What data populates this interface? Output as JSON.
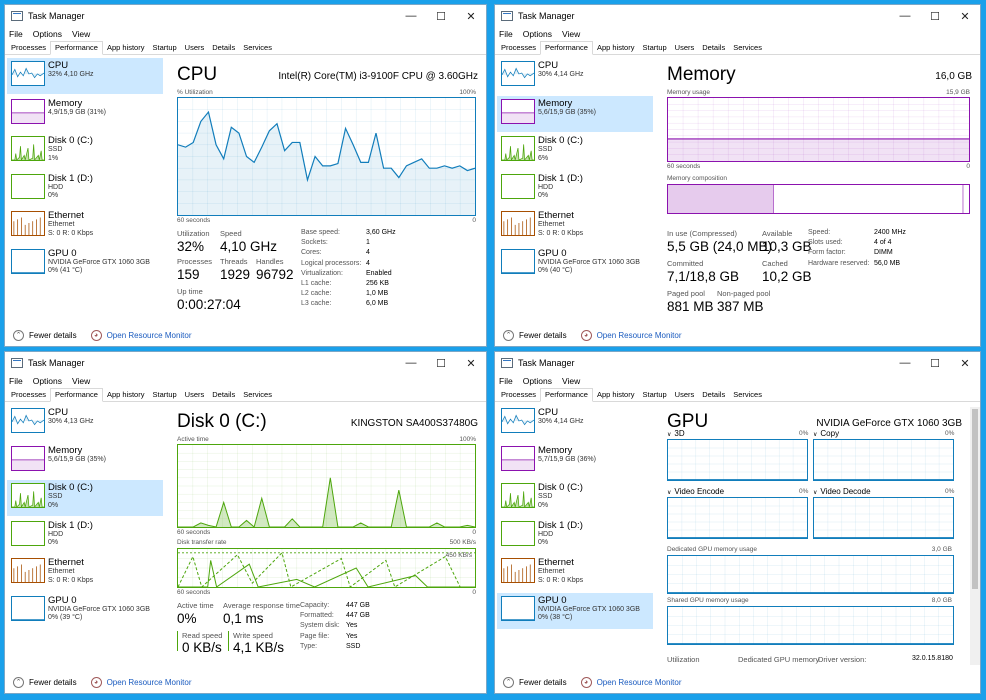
{
  "common": {
    "window_title": "Task Manager",
    "menu": [
      "File",
      "Options",
      "View"
    ],
    "tabs": [
      "Processes",
      "Performance",
      "App history",
      "Startup",
      "Users",
      "Details",
      "Services"
    ],
    "fewer_details": "Fewer details",
    "open_resource_monitor": "Open Resource Monitor",
    "colors": {
      "cpu": "#117dbb",
      "memory": "#8b12ae",
      "disk": "#4da60c",
      "ethernet": "#a74f01",
      "gpu": "#117dbb"
    }
  },
  "windows": [
    {
      "id": "cpu",
      "sidebar": [
        {
          "name": "CPU",
          "sub1": "32% 4,10 GHz",
          "sub2": "",
          "sub3": ""
        },
        {
          "name": "Memory",
          "sub1": "4,9/15,9 GB (31%)",
          "sub2": "",
          "sub3": ""
        },
        {
          "name": "Disk 0 (C:)",
          "sub1": "SSD",
          "sub2": "1%",
          "sub3": ""
        },
        {
          "name": "Disk 1 (D:)",
          "sub1": "HDD",
          "sub2": "0%",
          "sub3": ""
        },
        {
          "name": "Ethernet",
          "sub1": "Ethernet",
          "sub2": "S: 0 R: 0 Kbps",
          "sub3": ""
        },
        {
          "name": "GPU 0",
          "sub1": "NVIDIA GeForce GTX 1060 3GB",
          "sub2": "0% (41 °C)",
          "sub3": ""
        }
      ],
      "title": "CPU",
      "device": "Intel(R) Core(TM) i3-9100F CPU @ 3.60GHz",
      "graph_label_left": "% Utilization",
      "graph_label_right": "100%",
      "graph_bottom_left": "60 seconds",
      "graph_bottom_right": "0",
      "utilization_series": [
        60,
        58,
        62,
        80,
        88,
        60,
        48,
        75,
        70,
        50,
        45,
        58,
        72,
        78,
        55,
        62,
        62,
        30,
        50,
        42,
        42,
        44,
        74,
        60,
        45,
        45,
        70,
        40,
        40,
        32,
        42,
        45,
        48,
        40,
        40,
        42,
        40,
        42,
        38,
        40
      ],
      "stats": {
        "utilization_label": "Utilization",
        "utilization": "32%",
        "speed_label": "Speed",
        "speed": "4,10 GHz",
        "processes_label": "Processes",
        "processes": "159",
        "threads_label": "Threads",
        "threads": "1929",
        "handles_label": "Handles",
        "handles": "96792",
        "uptime_label": "Up time",
        "uptime": "0:00:27:04"
      },
      "specs": [
        {
          "k": "Base speed:",
          "v": "3,60 GHz"
        },
        {
          "k": "Sockets:",
          "v": "1"
        },
        {
          "k": "Cores:",
          "v": "4"
        },
        {
          "k": "Logical processors:",
          "v": "4"
        },
        {
          "k": "Virtualization:",
          "v": "Enabled"
        },
        {
          "k": "L1 cache:",
          "v": "256 KB"
        },
        {
          "k": "L2 cache:",
          "v": "1,0 MB"
        },
        {
          "k": "L3 cache:",
          "v": "6,0 MB"
        }
      ]
    },
    {
      "id": "memory",
      "sidebar": [
        {
          "name": "CPU",
          "sub1": "30% 4,14 GHz",
          "sub2": "",
          "sub3": ""
        },
        {
          "name": "Memory",
          "sub1": "5,6/15,9 GB (35%)",
          "sub2": "",
          "sub3": ""
        },
        {
          "name": "Disk 0 (C:)",
          "sub1": "SSD",
          "sub2": "6%",
          "sub3": ""
        },
        {
          "name": "Disk 1 (D:)",
          "sub1": "HDD",
          "sub2": "0%",
          "sub3": ""
        },
        {
          "name": "Ethernet",
          "sub1": "Ethernet",
          "sub2": "S: 0 R: 0 Kbps",
          "sub3": ""
        },
        {
          "name": "GPU 0",
          "sub1": "NVIDIA GeForce GTX 1060 3GB",
          "sub2": "0% (40 °C)",
          "sub3": ""
        }
      ],
      "title": "Memory",
      "device": "16,0 GB",
      "usage_label": "Memory usage",
      "usage_max": "15,9 GB",
      "usage_bottom_left": "60 seconds",
      "usage_bottom_right": "0",
      "usage_fraction": 0.35,
      "composition_label": "Memory composition",
      "stats": {
        "inuse_label": "In use (Compressed)",
        "inuse": "5,5 GB (24,0 MB)",
        "available_label": "Available",
        "available": "10,3 GB",
        "committed_label": "Committed",
        "committed": "7,1/18,8 GB",
        "cached_label": "Cached",
        "cached": "10,2 GB",
        "paged_label": "Paged pool",
        "paged": "881 MB",
        "nonpaged_label": "Non-paged pool",
        "nonpaged": "387 MB"
      },
      "specs": [
        {
          "k": "Speed:",
          "v": "2400 MHz"
        },
        {
          "k": "Slots used:",
          "v": "4 of 4"
        },
        {
          "k": "Form factor:",
          "v": "DIMM"
        },
        {
          "k": "Hardware reserved:",
          "v": "56,0 MB"
        }
      ]
    },
    {
      "id": "disk",
      "sidebar": [
        {
          "name": "CPU",
          "sub1": "30% 4,13 GHz",
          "sub2": "",
          "sub3": ""
        },
        {
          "name": "Memory",
          "sub1": "5,6/15,9 GB (35%)",
          "sub2": "",
          "sub3": ""
        },
        {
          "name": "Disk 0 (C:)",
          "sub1": "SSD",
          "sub2": "0%",
          "sub3": ""
        },
        {
          "name": "Disk 1 (D:)",
          "sub1": "HDD",
          "sub2": "0%",
          "sub3": ""
        },
        {
          "name": "Ethernet",
          "sub1": "Ethernet",
          "sub2": "S: 0 R: 0 Kbps",
          "sub3": ""
        },
        {
          "name": "GPU 0",
          "sub1": "NVIDIA GeForce GTX 1060 3GB",
          "sub2": "0% (39 °C)",
          "sub3": ""
        }
      ],
      "title": "Disk 0 (C:)",
      "device": "KINGSTON SA400S37480G",
      "active_label": "Active time",
      "active_max": "100%",
      "active_bottom_left": "60 seconds",
      "active_bottom_right": "0",
      "transfer_label": "Disk transfer rate",
      "transfer_max": "500 KB/s",
      "transfer_line_label": "450 KB/s",
      "transfer_bottom_left": "60 seconds",
      "transfer_bottom_right": "0",
      "active_series": [
        0,
        0,
        0,
        5,
        2,
        0,
        30,
        0,
        0,
        8,
        0,
        35,
        0,
        0,
        0,
        10,
        0,
        0,
        0,
        0,
        60,
        0,
        0,
        0,
        5,
        0,
        0,
        0,
        0,
        45,
        0,
        0,
        0,
        0,
        5,
        0,
        0,
        0,
        2,
        0
      ],
      "stats": {
        "active_label": "Active time",
        "active": "0%",
        "response_label": "Average response time",
        "response": "0,1 ms",
        "read_label": "Read speed",
        "read": "0 KB/s",
        "write_label": "Write speed",
        "write": "4,1 KB/s"
      },
      "specs": [
        {
          "k": "Capacity:",
          "v": "447 GB"
        },
        {
          "k": "Formatted:",
          "v": "447 GB"
        },
        {
          "k": "System disk:",
          "v": "Yes"
        },
        {
          "k": "Page file:",
          "v": "Yes"
        },
        {
          "k": "Type:",
          "v": "SSD"
        }
      ]
    },
    {
      "id": "gpu",
      "sidebar": [
        {
          "name": "CPU",
          "sub1": "30% 4,14 GHz",
          "sub2": "",
          "sub3": ""
        },
        {
          "name": "Memory",
          "sub1": "5,7/15,9 GB (36%)",
          "sub2": "",
          "sub3": ""
        },
        {
          "name": "Disk 0 (C:)",
          "sub1": "SSD",
          "sub2": "0%",
          "sub3": ""
        },
        {
          "name": "Disk 1 (D:)",
          "sub1": "HDD",
          "sub2": "0%",
          "sub3": ""
        },
        {
          "name": "Ethernet",
          "sub1": "Ethernet",
          "sub2": "S: 0 R: 0 Kbps",
          "sub3": ""
        },
        {
          "name": "GPU 0",
          "sub1": "NVIDIA GeForce GTX 1060 3GB",
          "sub2": "0% (38 °C)",
          "sub3": ""
        }
      ],
      "title": "GPU",
      "device": "NVIDIA GeForce GTX 1060 3GB",
      "engines": [
        {
          "name": "3D",
          "pct": "0%"
        },
        {
          "name": "Copy",
          "pct": "0%"
        },
        {
          "name": "Video Encode",
          "pct": "0%"
        },
        {
          "name": "Video Decode",
          "pct": "0%"
        }
      ],
      "dedicated_label": "Dedicated GPU memory usage",
      "dedicated_max": "3,0 GB",
      "shared_label": "Shared GPU memory usage",
      "shared_max": "8,0 GB",
      "bottom": {
        "utilization_label": "Utilization",
        "dedicated_label": "Dedicated GPU memory",
        "driver_label": "Driver version:",
        "driver": "32.0.15.8180"
      }
    }
  ]
}
